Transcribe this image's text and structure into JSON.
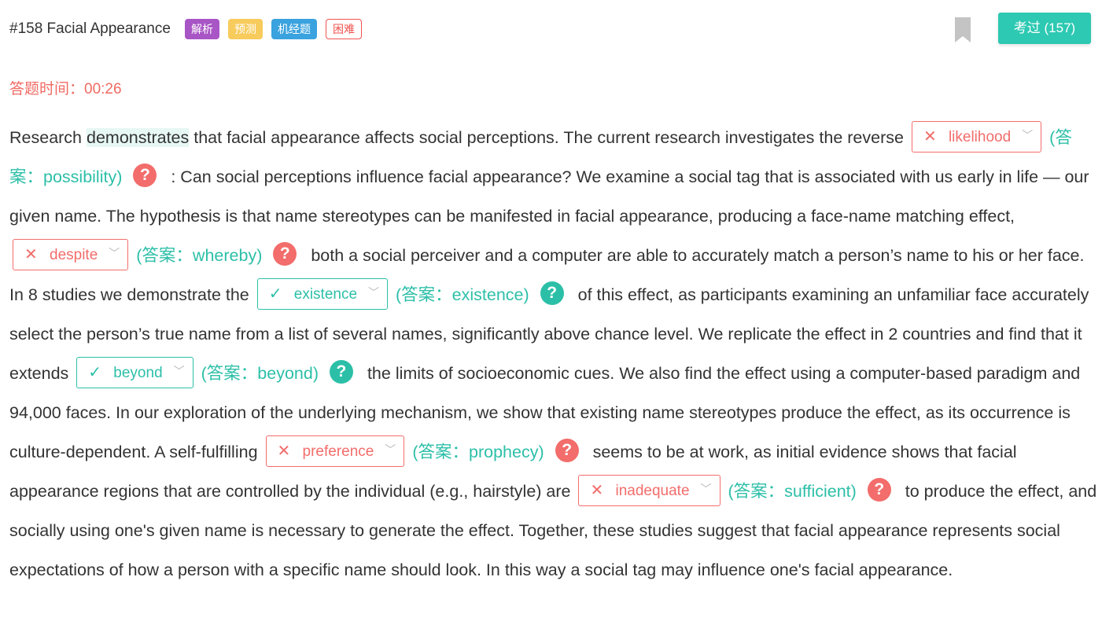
{
  "header": {
    "question_title": "#158 Facial Appearance",
    "tags": [
      "解析",
      "预测",
      "机经题",
      "困难"
    ],
    "passed_button": "考过 (157)"
  },
  "timer": {
    "label": "答题时间：",
    "value": "00:26"
  },
  "passage": {
    "seg0a": "Research ",
    "highlight": "demonstrates",
    "seg0b": " that facial appearance affects social perceptions. The current research investigates the reverse",
    "seg1": ": Can social perceptions influence facial appearance? We examine a social tag that is associated with us early in life — our given name. The hypothesis is that name stereotypes can be manifested in facial appearance, producing a face-name matching effect,",
    "seg2": " both a social perceiver and a computer are able to accurately match a person’s name to his or her face. In 8 studies we demonstrate the",
    "seg3": " of this effect, as participants examining an unfamiliar face accurately select the person’s true name from a list of several names, significantly above chance level. We replicate the effect in 2 countries and find that it extends",
    "seg4": " the limits of socioeconomic cues. We also find the effect using a computer-based paradigm and 94,000 faces. In our exploration of the underlying mechanism, we show that existing name stereotypes produce the effect, as its occurrence is culture-dependent. A self-fulfilling",
    "seg5": " seems to be at work, as initial evidence shows that facial appearance regions that are controlled by the individual (e.g., hairstyle) are",
    "seg6": " to produce the effect, and socially using one's given name is necessary to generate the effect. Together, these studies suggest that facial appearance represents social expectations of how a person with a specific name should look. In this way a social tag may influence one's facial appearance."
  },
  "blanks": [
    {
      "selected": "likelihood",
      "answer": "(答案：possibility)",
      "status": "wrong"
    },
    {
      "selected": "despite",
      "answer": "(答案：whereby)",
      "status": "wrong"
    },
    {
      "selected": "existence",
      "answer": "(答案：existence)",
      "status": "correct"
    },
    {
      "selected": "beyond",
      "answer": "(答案：beyond)",
      "status": "correct"
    },
    {
      "selected": "preference",
      "answer": "(答案：prophecy)",
      "status": "wrong"
    },
    {
      "selected": "inadequate",
      "answer": "(答案：sufficient)",
      "status": "wrong"
    }
  ],
  "icons": {
    "wrong_mark": "✕",
    "correct_mark": "✓",
    "dropdown": "chevron-down-icon",
    "help": "?"
  },
  "colors": {
    "accent": "#2dc9b2",
    "correct": "#2cbfa8",
    "wrong": "#f26d6b",
    "tag_analysis": "#a855c5",
    "tag_predict": "#f7cb5c",
    "tag_machine": "#3aa2de"
  }
}
